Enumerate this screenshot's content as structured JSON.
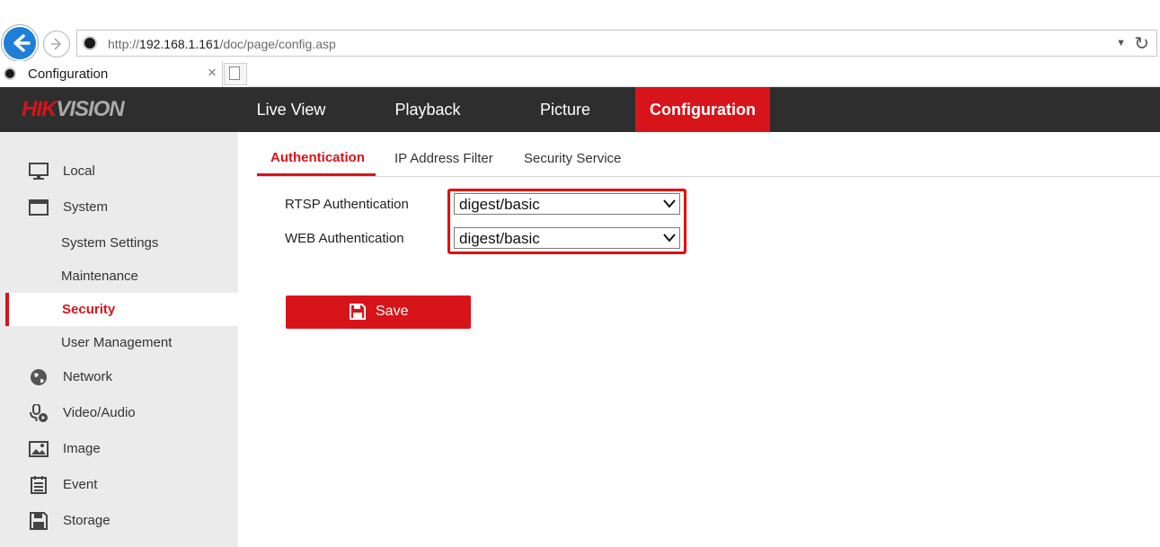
{
  "browser": {
    "url_prefix": "http://",
    "url_host": "192.168.1.161",
    "url_path": "/doc/page/config.asp",
    "tab_title": "Configuration",
    "tab_close": "×"
  },
  "header": {
    "logo_hik": "HIK",
    "logo_vision": "VISION",
    "nav": [
      {
        "label": "Live View"
      },
      {
        "label": "Playback"
      },
      {
        "label": "Picture"
      },
      {
        "label": "Configuration",
        "active": true
      }
    ]
  },
  "sidebar": {
    "items": [
      {
        "label": "Local",
        "icon": "monitor-icon"
      },
      {
        "label": "System",
        "icon": "window-icon"
      },
      {
        "label": "System Settings"
      },
      {
        "label": "Maintenance"
      },
      {
        "label": "Security",
        "active": true
      },
      {
        "label": "User Management"
      },
      {
        "label": "Network",
        "icon": "globe-icon"
      },
      {
        "label": "Video/Audio",
        "icon": "microphone-icon"
      },
      {
        "label": "Image",
        "icon": "image-icon"
      },
      {
        "label": "Event",
        "icon": "calendar-icon"
      },
      {
        "label": "Storage",
        "icon": "floppy-disk-icon"
      }
    ]
  },
  "content": {
    "tabs": [
      {
        "label": "Authentication",
        "active": true
      },
      {
        "label": "IP Address Filter"
      },
      {
        "label": "Security Service"
      }
    ],
    "form": {
      "rtsp_label": "RTSP Authentication",
      "rtsp_value": "digest/basic",
      "web_label": "WEB Authentication",
      "web_value": "digest/basic"
    },
    "save_label": "Save"
  },
  "colors": {
    "accent": "#d7141a",
    "header_bg": "#2e2e2e",
    "sidebar_bg": "#ebebeb",
    "highlight": "#e8000b"
  }
}
